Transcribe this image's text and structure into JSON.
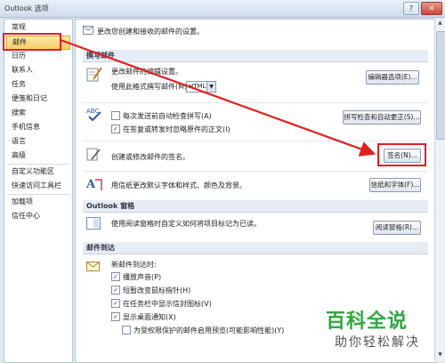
{
  "window": {
    "title": "Outlook 选项"
  },
  "sidebar": {
    "items": [
      {
        "label": "常规"
      },
      {
        "label": "邮件"
      },
      {
        "label": "日历"
      },
      {
        "label": "联系人"
      },
      {
        "label": "任务"
      },
      {
        "label": "便笺和日记"
      },
      {
        "label": "搜索"
      },
      {
        "label": "手机信息"
      },
      {
        "label": "语言"
      },
      {
        "label": "高级"
      },
      {
        "label": "自定义功能区"
      },
      {
        "label": "快速访问工具栏"
      },
      {
        "label": "加载项"
      },
      {
        "label": "信任中心"
      }
    ],
    "selected": "邮件"
  },
  "main": {
    "intro": "更改您创建和接收的邮件的设置。",
    "compose": {
      "header": "撰写邮件",
      "line1": "更改邮件的编辑设置。",
      "format_label": "使用此格式撰写邮件(M):",
      "format_value": "HTML",
      "editor_button": "编辑器选项(E)...",
      "spell_check": "每次发送前自动检查拼写(A)",
      "ignore_original": "在答复或转发时忽略原件的正文(I)",
      "spelling_button": "拼写检查和自动更正(S)...",
      "signature_text": "创建或修改邮件的签名。",
      "signature_button": "签名(N)...",
      "stationery_text": "用信纸更改默认字体和样式、颜色及背景。",
      "stationery_button": "信纸和字体(F)..."
    },
    "pane": {
      "header": "Outlook 窗格",
      "text": "使用阅读窗格时自定义如何将项目标记为已读。",
      "button": "阅读窗格(R)..."
    },
    "arrival": {
      "header": "邮件到达",
      "intro": "新邮件到达时:",
      "options": [
        "播放声音(P)",
        "短暂改变鼠标指针(H)",
        "在任务栏中显示信封图标(V)",
        "显示桌面通知(X)"
      ],
      "rights_preview": "为受权限保护的邮件启用预览(可能影响性能)(Y)"
    }
  },
  "watermark": {
    "line1": "百科全说",
    "line2": "助你轻松解决"
  },
  "colors": {
    "accent_red": "#e02020",
    "selection": "#f7cf66",
    "watermark_green": "#2fa83f"
  }
}
